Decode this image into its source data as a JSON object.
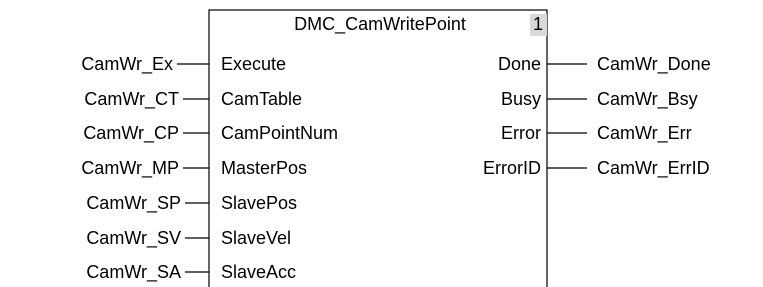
{
  "block": {
    "name": "DMC_CamWritePoint",
    "instance_number": "1"
  },
  "inputs": [
    {
      "variable": "CamWr_Ex",
      "pin": "Execute"
    },
    {
      "variable": "CamWr_CT",
      "pin": "CamTable"
    },
    {
      "variable": "CamWr_CP",
      "pin": "CamPointNum"
    },
    {
      "variable": "CamWr_MP",
      "pin": "MasterPos"
    },
    {
      "variable": "CamWr_SP",
      "pin": "SlavePos"
    },
    {
      "variable": "CamWr_SV",
      "pin": "SlaveVel"
    },
    {
      "variable": "CamWr_SA",
      "pin": "SlaveAcc"
    }
  ],
  "outputs": [
    {
      "pin": "Done",
      "variable": "CamWr_Done"
    },
    {
      "pin": "Busy",
      "variable": "CamWr_Bsy"
    },
    {
      "pin": "Error",
      "variable": "CamWr_Err"
    },
    {
      "pin": "ErrorID",
      "variable": "CamWr_ErrID"
    }
  ],
  "colors": {
    "line": "#000000",
    "background": "#ffffff",
    "instance_box": "#d9d9d9"
  }
}
